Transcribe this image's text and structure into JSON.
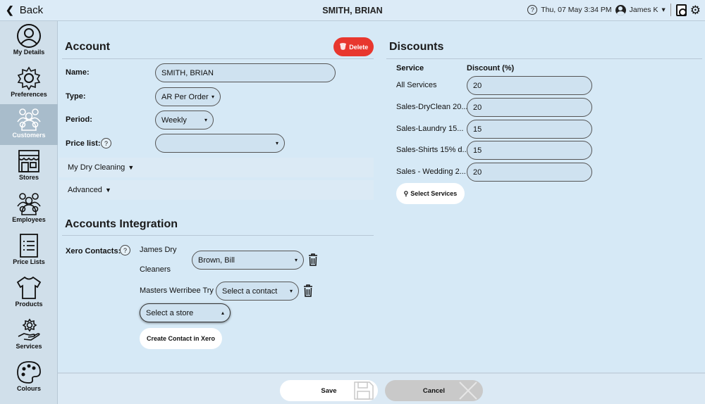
{
  "topbar": {
    "back_label": "Back",
    "title": "SMITH, BRIAN",
    "help_glyph": "?",
    "datetime": "Thu, 07 May 3:34 PM",
    "user_name": "James K",
    "user_caret": "▾",
    "icons": [
      "back-chevron-icon",
      "help-icon",
      "user-icon",
      "washing-machine-icon",
      "gear-icon"
    ]
  },
  "sidebar": {
    "items": [
      {
        "label": "My Details",
        "icon": "user-circle-icon"
      },
      {
        "label": "Preferences",
        "icon": "gear-outline-icon"
      },
      {
        "label": "Customers",
        "icon": "customers-group-icon",
        "active": true
      },
      {
        "label": "Stores",
        "icon": "store-icon"
      },
      {
        "label": "Employees",
        "icon": "employees-group-icon"
      },
      {
        "label": "Price Lists",
        "icon": "price-list-icon"
      },
      {
        "label": "Products",
        "icon": "shirt-icon"
      },
      {
        "label": "Services",
        "icon": "hand-gear-icon"
      },
      {
        "label": "Colours",
        "icon": "palette-icon"
      }
    ],
    "active_color": "#a8bccb"
  },
  "account": {
    "heading": "Account",
    "delete_label": "Delete",
    "delete_color": "#e8372e",
    "name_label": "Name:",
    "name_value": "SMITH, BRIAN",
    "type_label": "Type:",
    "type_value": "AR Per Order",
    "period_label": "Period:",
    "period_value": "Weekly",
    "pricelist_label": "Price list:",
    "pricelist_value": "",
    "help_glyph": "?",
    "caret": "▾",
    "expander_caret": "▼",
    "my_dry_cleaning": "My Dry Cleaning",
    "advanced": "Advanced"
  },
  "integration": {
    "heading": "Accounts Integration",
    "xero_label": "Xero Contacts:",
    "help_glyph": "?",
    "row1_store_line1": "James Dry",
    "row1_store_line2": "Cleaners",
    "row1_contact": "Brown, Bill",
    "row2_store": "Masters Werribee Try",
    "row2_contact": "Select a contact",
    "caret": "▾",
    "open_caret": "▴",
    "store_select": "Select a store",
    "create_button": "Create Contact in Xero"
  },
  "discounts": {
    "heading": "Discounts",
    "col_service": "Service",
    "col_discount": "Discount (%)",
    "rows": [
      {
        "service": "All Services",
        "discount": "20"
      },
      {
        "service": "Sales-DryClean 20...",
        "discount": "20"
      },
      {
        "service": "Sales-Laundry 15...",
        "discount": "15"
      },
      {
        "service": "Sales-Shirts 15% d...",
        "discount": "15"
      },
      {
        "service": "Sales - Wedding 2...",
        "discount": "20"
      }
    ],
    "select_services": "Select Services"
  },
  "footer": {
    "save_label": "Save",
    "cancel_label": "Cancel"
  }
}
